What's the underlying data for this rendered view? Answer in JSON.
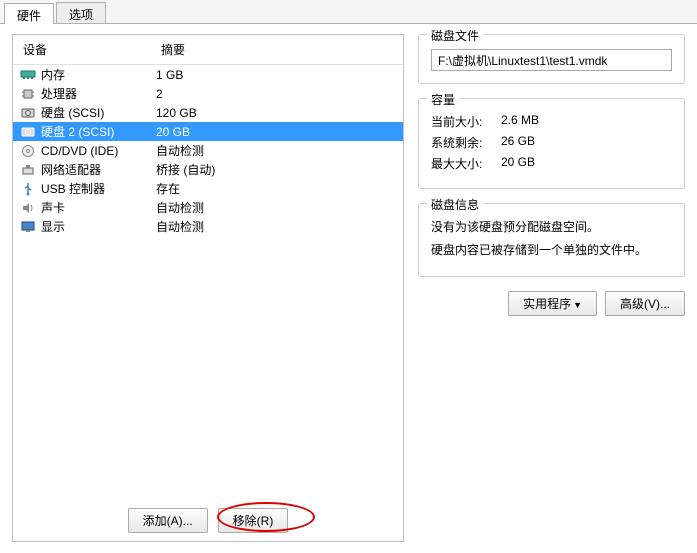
{
  "tabs": {
    "hardware": "硬件",
    "options": "选项"
  },
  "headers": {
    "device": "设备",
    "summary": "摘要"
  },
  "hardware_items": [
    {
      "name": "内存",
      "summary": "1 GB",
      "icon": "memory-icon"
    },
    {
      "name": "处理器",
      "summary": "2",
      "icon": "cpu-icon"
    },
    {
      "name": "硬盘 (SCSI)",
      "summary": "120 GB",
      "icon": "disk-icon"
    },
    {
      "name": "硬盘 2 (SCSI)",
      "summary": "20 GB",
      "icon": "disk-icon",
      "selected": true
    },
    {
      "name": "CD/DVD (IDE)",
      "summary": "自动检测",
      "icon": "cd-icon"
    },
    {
      "name": "网络适配器",
      "summary": "桥接 (自动)",
      "icon": "network-icon"
    },
    {
      "name": "USB 控制器",
      "summary": "存在",
      "icon": "usb-icon"
    },
    {
      "name": "声卡",
      "summary": "自动检测",
      "icon": "sound-icon"
    },
    {
      "name": "显示",
      "summary": "自动检测",
      "icon": "display-icon"
    }
  ],
  "buttons": {
    "add": "添加(A)...",
    "remove": "移除(R)",
    "utility": "实用程序",
    "advanced": "高级(V)..."
  },
  "groups": {
    "disk_file": {
      "title": "磁盘文件",
      "value": "F:\\虚拟机\\Linuxtest1\\test1.vmdk"
    },
    "capacity": {
      "title": "容量",
      "current_label": "当前大小:",
      "current_value": "2.6 MB",
      "free_label": "系统剩余:",
      "free_value": "26 GB",
      "max_label": "最大大小:",
      "max_value": "20 GB"
    },
    "disk_info": {
      "title": "磁盘信息",
      "line1": "没有为该硬盘预分配磁盘空间。",
      "line2": "硬盘内容已被存储到一个单独的文件中。"
    }
  }
}
